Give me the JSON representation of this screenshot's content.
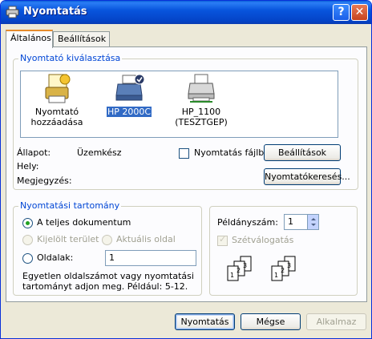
{
  "window": {
    "title": "Nyomtatás"
  },
  "title_buttons": {
    "help": "?",
    "close": "✕"
  },
  "tabs": [
    {
      "label": "Általános",
      "active": true
    },
    {
      "label": "Beállítások",
      "active": false
    }
  ],
  "printer_select": {
    "legend": "Nyomtató kiválasztása",
    "printers": [
      {
        "line1": "Nyomtató",
        "line2": "hozzáadása",
        "icon": "add-printer-icon",
        "selected": false
      },
      {
        "line1": "HP 2000C",
        "line2": "",
        "icon": "printer-default-icon",
        "selected": true
      },
      {
        "line1": "HP_1100",
        "line2": "(TESZTGEP)",
        "icon": "network-printer-icon",
        "selected": false
      }
    ],
    "status_label": "Állapot:",
    "status_value": "Üzemkész",
    "location_label": "Hely:",
    "comment_label": "Megjegyzés:",
    "print_to_file_label": "Nyomtatás fájlba",
    "settings_button": "Beállítások",
    "find_printer_button": "Nyomtatókeresés..."
  },
  "page_range": {
    "legend": "Nyomtatási tartomány",
    "all_label": "A teljes dokumentum",
    "selection_label": "Kijelölt terület",
    "current_label": "Aktuális oldal",
    "pages_label": "Oldalak:",
    "pages_value": "1",
    "hint_line1": "Egyetlen oldalszámot vagy nyomtatási",
    "hint_line2": "tartományt adjon meg. Például: 5-12."
  },
  "copies": {
    "label": "Példányszám:",
    "value": "1",
    "collate_label": "Szétválogatás",
    "collate_checked": true,
    "stack_pages": [
      "1",
      "2",
      "3"
    ]
  },
  "buttons": {
    "print": "Nyomtatás",
    "cancel": "Mégse",
    "apply": "Alkalmaz"
  },
  "colors": {
    "title_bar": "#0855dd",
    "legend": "#0046d5",
    "selection": "#316ac5",
    "dialog_bg": "#ece9d8"
  }
}
